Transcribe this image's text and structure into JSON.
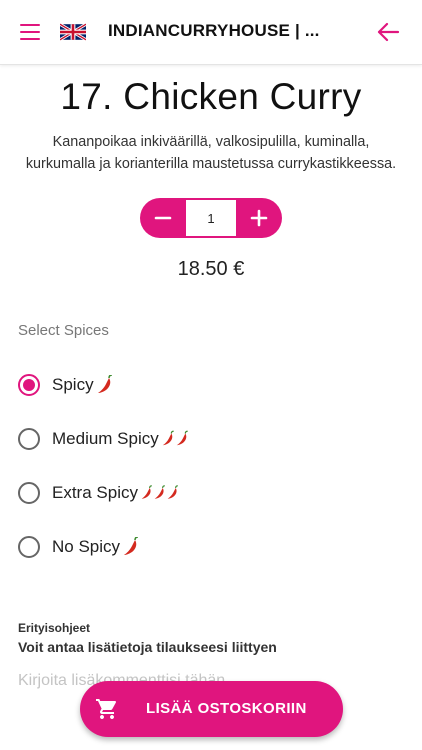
{
  "header": {
    "title": "INDIANCURRYHOUSE | ...",
    "menu_icon": "hamburger-menu-icon",
    "flag_icon": "uk-flag-icon",
    "back_icon": "arrow-left-icon"
  },
  "dish": {
    "title": "17. Chicken Curry",
    "description_line1": "Kananpoikaa inkiväärillä, valkosipulilla, kuminalla,",
    "description_line2": "kurkumalla ja korianterilla maustetussa currykastikkeessa.",
    "quantity": "1",
    "price": "18.50 €"
  },
  "spices": {
    "label": "Select Spices",
    "selected": "Spicy",
    "options": [
      {
        "label": "Spicy",
        "chilis": 1
      },
      {
        "label": "Medium Spicy",
        "chilis": 2
      },
      {
        "label": "Extra Spicy",
        "chilis": 3
      },
      {
        "label": "No Spicy",
        "chilis": 1
      }
    ]
  },
  "notes": {
    "heading": "Erityisohjeet",
    "subheading": "Voit antaa lisätietoja tilaukseesi liittyen",
    "placeholder": "Kirjoita lisäkommenttisi tähän"
  },
  "cart": {
    "label": "LISÄÄ OSTOSKORIIN",
    "icon": "shopping-cart-icon"
  },
  "colors": {
    "accent": "#e0157e",
    "chili": "#d42a1f"
  }
}
